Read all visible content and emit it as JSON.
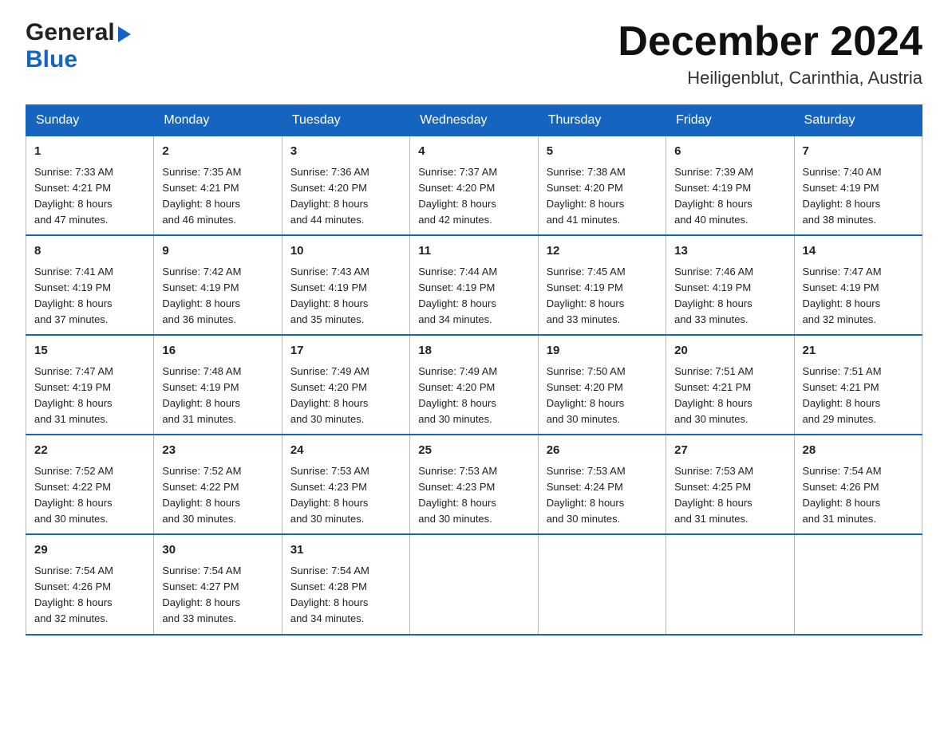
{
  "header": {
    "logo_line1": "General",
    "logo_line2": "Blue",
    "month_title": "December 2024",
    "location": "Heiligenblut, Carinthia, Austria"
  },
  "calendar": {
    "days_of_week": [
      "Sunday",
      "Monday",
      "Tuesday",
      "Wednesday",
      "Thursday",
      "Friday",
      "Saturday"
    ],
    "weeks": [
      [
        {
          "day": "1",
          "sunrise": "Sunrise: 7:33 AM",
          "sunset": "Sunset: 4:21 PM",
          "daylight": "Daylight: 8 hours",
          "minutes": "and 47 minutes."
        },
        {
          "day": "2",
          "sunrise": "Sunrise: 7:35 AM",
          "sunset": "Sunset: 4:21 PM",
          "daylight": "Daylight: 8 hours",
          "minutes": "and 46 minutes."
        },
        {
          "day": "3",
          "sunrise": "Sunrise: 7:36 AM",
          "sunset": "Sunset: 4:20 PM",
          "daylight": "Daylight: 8 hours",
          "minutes": "and 44 minutes."
        },
        {
          "day": "4",
          "sunrise": "Sunrise: 7:37 AM",
          "sunset": "Sunset: 4:20 PM",
          "daylight": "Daylight: 8 hours",
          "minutes": "and 42 minutes."
        },
        {
          "day": "5",
          "sunrise": "Sunrise: 7:38 AM",
          "sunset": "Sunset: 4:20 PM",
          "daylight": "Daylight: 8 hours",
          "minutes": "and 41 minutes."
        },
        {
          "day": "6",
          "sunrise": "Sunrise: 7:39 AM",
          "sunset": "Sunset: 4:19 PM",
          "daylight": "Daylight: 8 hours",
          "minutes": "and 40 minutes."
        },
        {
          "day": "7",
          "sunrise": "Sunrise: 7:40 AM",
          "sunset": "Sunset: 4:19 PM",
          "daylight": "Daylight: 8 hours",
          "minutes": "and 38 minutes."
        }
      ],
      [
        {
          "day": "8",
          "sunrise": "Sunrise: 7:41 AM",
          "sunset": "Sunset: 4:19 PM",
          "daylight": "Daylight: 8 hours",
          "minutes": "and 37 minutes."
        },
        {
          "day": "9",
          "sunrise": "Sunrise: 7:42 AM",
          "sunset": "Sunset: 4:19 PM",
          "daylight": "Daylight: 8 hours",
          "minutes": "and 36 minutes."
        },
        {
          "day": "10",
          "sunrise": "Sunrise: 7:43 AM",
          "sunset": "Sunset: 4:19 PM",
          "daylight": "Daylight: 8 hours",
          "minutes": "and 35 minutes."
        },
        {
          "day": "11",
          "sunrise": "Sunrise: 7:44 AM",
          "sunset": "Sunset: 4:19 PM",
          "daylight": "Daylight: 8 hours",
          "minutes": "and 34 minutes."
        },
        {
          "day": "12",
          "sunrise": "Sunrise: 7:45 AM",
          "sunset": "Sunset: 4:19 PM",
          "daylight": "Daylight: 8 hours",
          "minutes": "and 33 minutes."
        },
        {
          "day": "13",
          "sunrise": "Sunrise: 7:46 AM",
          "sunset": "Sunset: 4:19 PM",
          "daylight": "Daylight: 8 hours",
          "minutes": "and 33 minutes."
        },
        {
          "day": "14",
          "sunrise": "Sunrise: 7:47 AM",
          "sunset": "Sunset: 4:19 PM",
          "daylight": "Daylight: 8 hours",
          "minutes": "and 32 minutes."
        }
      ],
      [
        {
          "day": "15",
          "sunrise": "Sunrise: 7:47 AM",
          "sunset": "Sunset: 4:19 PM",
          "daylight": "Daylight: 8 hours",
          "minutes": "and 31 minutes."
        },
        {
          "day": "16",
          "sunrise": "Sunrise: 7:48 AM",
          "sunset": "Sunset: 4:19 PM",
          "daylight": "Daylight: 8 hours",
          "minutes": "and 31 minutes."
        },
        {
          "day": "17",
          "sunrise": "Sunrise: 7:49 AM",
          "sunset": "Sunset: 4:20 PM",
          "daylight": "Daylight: 8 hours",
          "minutes": "and 30 minutes."
        },
        {
          "day": "18",
          "sunrise": "Sunrise: 7:49 AM",
          "sunset": "Sunset: 4:20 PM",
          "daylight": "Daylight: 8 hours",
          "minutes": "and 30 minutes."
        },
        {
          "day": "19",
          "sunrise": "Sunrise: 7:50 AM",
          "sunset": "Sunset: 4:20 PM",
          "daylight": "Daylight: 8 hours",
          "minutes": "and 30 minutes."
        },
        {
          "day": "20",
          "sunrise": "Sunrise: 7:51 AM",
          "sunset": "Sunset: 4:21 PM",
          "daylight": "Daylight: 8 hours",
          "minutes": "and 30 minutes."
        },
        {
          "day": "21",
          "sunrise": "Sunrise: 7:51 AM",
          "sunset": "Sunset: 4:21 PM",
          "daylight": "Daylight: 8 hours",
          "minutes": "and 29 minutes."
        }
      ],
      [
        {
          "day": "22",
          "sunrise": "Sunrise: 7:52 AM",
          "sunset": "Sunset: 4:22 PM",
          "daylight": "Daylight: 8 hours",
          "minutes": "and 30 minutes."
        },
        {
          "day": "23",
          "sunrise": "Sunrise: 7:52 AM",
          "sunset": "Sunset: 4:22 PM",
          "daylight": "Daylight: 8 hours",
          "minutes": "and 30 minutes."
        },
        {
          "day": "24",
          "sunrise": "Sunrise: 7:53 AM",
          "sunset": "Sunset: 4:23 PM",
          "daylight": "Daylight: 8 hours",
          "minutes": "and 30 minutes."
        },
        {
          "day": "25",
          "sunrise": "Sunrise: 7:53 AM",
          "sunset": "Sunset: 4:23 PM",
          "daylight": "Daylight: 8 hours",
          "minutes": "and 30 minutes."
        },
        {
          "day": "26",
          "sunrise": "Sunrise: 7:53 AM",
          "sunset": "Sunset: 4:24 PM",
          "daylight": "Daylight: 8 hours",
          "minutes": "and 30 minutes."
        },
        {
          "day": "27",
          "sunrise": "Sunrise: 7:53 AM",
          "sunset": "Sunset: 4:25 PM",
          "daylight": "Daylight: 8 hours",
          "minutes": "and 31 minutes."
        },
        {
          "day": "28",
          "sunrise": "Sunrise: 7:54 AM",
          "sunset": "Sunset: 4:26 PM",
          "daylight": "Daylight: 8 hours",
          "minutes": "and 31 minutes."
        }
      ],
      [
        {
          "day": "29",
          "sunrise": "Sunrise: 7:54 AM",
          "sunset": "Sunset: 4:26 PM",
          "daylight": "Daylight: 8 hours",
          "minutes": "and 32 minutes."
        },
        {
          "day": "30",
          "sunrise": "Sunrise: 7:54 AM",
          "sunset": "Sunset: 4:27 PM",
          "daylight": "Daylight: 8 hours",
          "minutes": "and 33 minutes."
        },
        {
          "day": "31",
          "sunrise": "Sunrise: 7:54 AM",
          "sunset": "Sunset: 4:28 PM",
          "daylight": "Daylight: 8 hours",
          "minutes": "and 34 minutes."
        },
        null,
        null,
        null,
        null
      ]
    ]
  }
}
